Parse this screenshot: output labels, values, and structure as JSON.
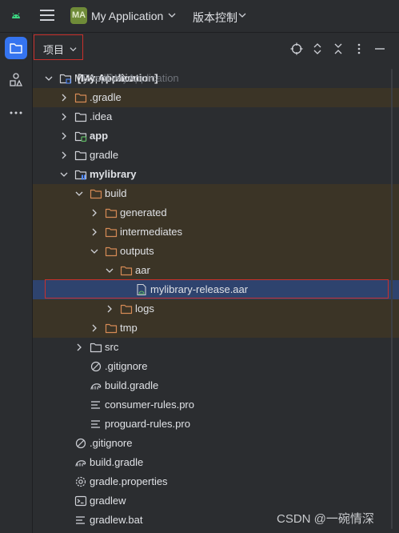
{
  "titlebar": {
    "android_icon": "android-icon",
    "menu_icon": "hamburger-menu-icon",
    "project_badge": "MA",
    "project_name": "My Application",
    "vcs_label": "版本控制"
  },
  "stripe": {
    "tools": [
      {
        "name": "project-tool-icon",
        "active": true
      },
      {
        "name": "structure-tool-icon",
        "active": false
      },
      {
        "name": "more-tools-icon",
        "active": false
      }
    ]
  },
  "panel": {
    "view_label": "项目",
    "actions": [
      "locate-icon",
      "expand-all-icon",
      "collapse-all-icon",
      "options-icon",
      "hide-icon"
    ]
  },
  "colors": {
    "accent": "#3574f0",
    "excluded_row_bg": "#3b3426",
    "selected_row_bg": "#2e436e",
    "folder_orange": "#d58a55",
    "folder_gray": "#ced0d6",
    "module_green": "#5fb865",
    "highlight_red": "#c9302c"
  },
  "tree": [
    {
      "label": "MyApplication",
      "bold_suffix": "[My Application]",
      "path": "E:\\sdk\\MyApplication",
      "depth": 0,
      "arrow": "down",
      "icon": "project-module-icon",
      "excluded": false
    },
    {
      "label": ".gradle",
      "depth": 1,
      "arrow": "right",
      "icon": "folder-orange-icon",
      "excluded": true
    },
    {
      "label": ".idea",
      "depth": 1,
      "arrow": "right",
      "icon": "folder-icon",
      "excluded": false
    },
    {
      "label": "app",
      "depth": 1,
      "arrow": "right",
      "icon": "app-module-icon",
      "excluded": false,
      "bold": true
    },
    {
      "label": "gradle",
      "depth": 1,
      "arrow": "right",
      "icon": "folder-icon",
      "excluded": false
    },
    {
      "label": "mylibrary",
      "depth": 1,
      "arrow": "down",
      "icon": "library-module-icon",
      "excluded": false,
      "bold": true
    },
    {
      "label": "build",
      "depth": 2,
      "arrow": "down",
      "icon": "folder-orange-icon",
      "excluded": true
    },
    {
      "label": "generated",
      "depth": 3,
      "arrow": "right",
      "icon": "folder-orange-icon",
      "excluded": true
    },
    {
      "label": "intermediates",
      "depth": 3,
      "arrow": "right",
      "icon": "folder-orange-icon",
      "excluded": true
    },
    {
      "label": "outputs",
      "depth": 3,
      "arrow": "down",
      "icon": "folder-orange-icon",
      "excluded": true
    },
    {
      "label": "aar",
      "depth": 4,
      "arrow": "down",
      "icon": "folder-orange-icon",
      "excluded": true
    },
    {
      "label": "mylibrary-release.aar",
      "depth": 5,
      "arrow": "none",
      "icon": "aar-file-icon",
      "excluded": false,
      "selected": true
    },
    {
      "label": "logs",
      "depth": 4,
      "arrow": "right",
      "icon": "folder-orange-icon",
      "excluded": true
    },
    {
      "label": "tmp",
      "depth": 3,
      "arrow": "right",
      "icon": "folder-orange-icon",
      "excluded": true
    },
    {
      "label": "src",
      "depth": 2,
      "arrow": "right",
      "icon": "folder-icon",
      "excluded": false
    },
    {
      "label": ".gitignore",
      "depth": 2,
      "arrow": "none",
      "icon": "ignore-file-icon",
      "excluded": false
    },
    {
      "label": "build.gradle",
      "depth": 2,
      "arrow": "none",
      "icon": "gradle-file-icon",
      "excluded": false
    },
    {
      "label": "consumer-rules.pro",
      "depth": 2,
      "arrow": "none",
      "icon": "text-file-icon",
      "excluded": false
    },
    {
      "label": "proguard-rules.pro",
      "depth": 2,
      "arrow": "none",
      "icon": "text-file-icon",
      "excluded": false
    },
    {
      "label": ".gitignore",
      "depth": 1,
      "arrow": "none",
      "icon": "ignore-file-icon",
      "excluded": false
    },
    {
      "label": "build.gradle",
      "depth": 1,
      "arrow": "none",
      "icon": "gradle-file-icon",
      "excluded": false
    },
    {
      "label": "gradle.properties",
      "depth": 1,
      "arrow": "none",
      "icon": "settings-file-icon",
      "excluded": false
    },
    {
      "label": "gradlew",
      "depth": 1,
      "arrow": "none",
      "icon": "terminal-file-icon",
      "excluded": false
    },
    {
      "label": "gradlew.bat",
      "depth": 1,
      "arrow": "none",
      "icon": "text-file-icon",
      "excluded": false
    }
  ],
  "watermark": "CSDN @一碗情深"
}
